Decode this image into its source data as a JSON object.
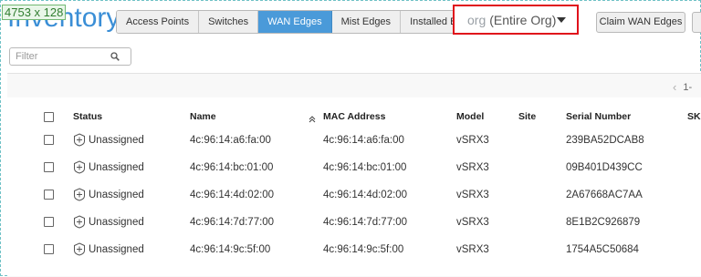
{
  "badge": {
    "text": "4753 x 128"
  },
  "page_title": "Inventory",
  "tabs": [
    {
      "label": "Access Points",
      "active": false
    },
    {
      "label": "Switches",
      "active": false
    },
    {
      "label": "WAN Edges",
      "active": true
    },
    {
      "label": "Mist Edges",
      "active": false
    },
    {
      "label": "Installed Base",
      "active": false
    }
  ],
  "org_select": {
    "prefix": "org",
    "value": "(Entire Org)"
  },
  "claim_button": {
    "label": "Claim WAN Edges"
  },
  "filter": {
    "placeholder": "Filter"
  },
  "pager": {
    "text": "1-"
  },
  "columns": {
    "status": "Status",
    "name": "Name",
    "mac": "MAC Address",
    "model": "Model",
    "site": "Site",
    "serial": "Serial Number",
    "sku": "SKU"
  },
  "rows": [
    {
      "status": "Unassigned",
      "name": "4c:96:14:a6:fa:00",
      "mac": "4c:96:14:a6:fa:00",
      "model": "vSRX3",
      "site": "",
      "serial": "239BA52DCAB8"
    },
    {
      "status": "Unassigned",
      "name": "4c:96:14:bc:01:00",
      "mac": "4c:96:14:bc:01:00",
      "model": "vSRX3",
      "site": "",
      "serial": "09B401D439CC"
    },
    {
      "status": "Unassigned",
      "name": "4c:96:14:4d:02:00",
      "mac": "4c:96:14:4d:02:00",
      "model": "vSRX3",
      "site": "",
      "serial": "2A67668AC7AA"
    },
    {
      "status": "Unassigned",
      "name": "4c:96:14:7d:77:00",
      "mac": "4c:96:14:7d:77:00",
      "model": "vSRX3",
      "site": "",
      "serial": "8E1B2C926879"
    },
    {
      "status": "Unassigned",
      "name": "4c:96:14:9c:5f:00",
      "mac": "4c:96:14:9c:5f:00",
      "model": "vSRX3",
      "site": "",
      "serial": "1754A5C50684"
    }
  ],
  "colors": {
    "accent": "#4a9ad9",
    "title": "#3a8ed6",
    "highlight": "#e0121b",
    "badge": "#2f7d2f"
  },
  "icons": {
    "search": "search-icon",
    "caret": "chevron-down-icon",
    "sort": "sort-ascending-icon",
    "status": "plus-circle-icon",
    "prev": "chevron-left-icon"
  }
}
